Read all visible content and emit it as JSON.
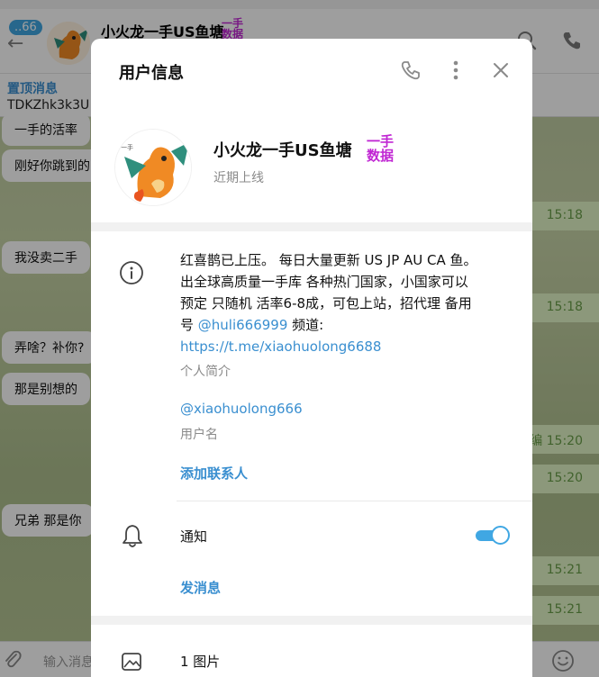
{
  "chat": {
    "unread": "..66",
    "title": "小火龙一手US鱼塘",
    "badge_line1": "一手",
    "badge_line2": "数据",
    "pinned_title": "置顶消息",
    "pinned_text": "TDKZhk3k3U",
    "messages_in": [
      "一手的活率",
      "刚好你跳到的",
      "我没卖二手",
      "弄啥？补你?",
      "那是别想的",
      "兄弟 那是你"
    ],
    "times": [
      "15:18",
      "15:18",
      "编 15:20",
      "15:20",
      "15:21",
      "15:21"
    ],
    "composer_placeholder": "输入消息"
  },
  "modal": {
    "title": "用户信息",
    "name": "小火龙一手US鱼塘",
    "badge_line1": "一手",
    "badge_line2": "数据",
    "status": "近期上线",
    "bio_lines": [
      "红喜鹊已上压。 每日大量更新 US JP AU CA 鱼。",
      "出全球高质量一手库 各种热门国家，小国家可以",
      "预定 只随机 活率6-8成，可包上站，招代理 备用"
    ],
    "bio_prefix": "号 ",
    "bio_handle": "@huli666999",
    "bio_suffix": " 频道:",
    "bio_link": "https://t.me/xiaohuolong6688",
    "bio_caption": "个人简介",
    "username": "@xiaohuolong666",
    "username_caption": "用户名",
    "add_contact": "添加联系人",
    "notifications_label": "通知",
    "notifications_on": true,
    "send_message": "发消息",
    "media_label": "1 图片"
  },
  "colors": {
    "accent": "#40a7e3",
    "link": "#3a8fd0",
    "badge": "#c026d3"
  }
}
